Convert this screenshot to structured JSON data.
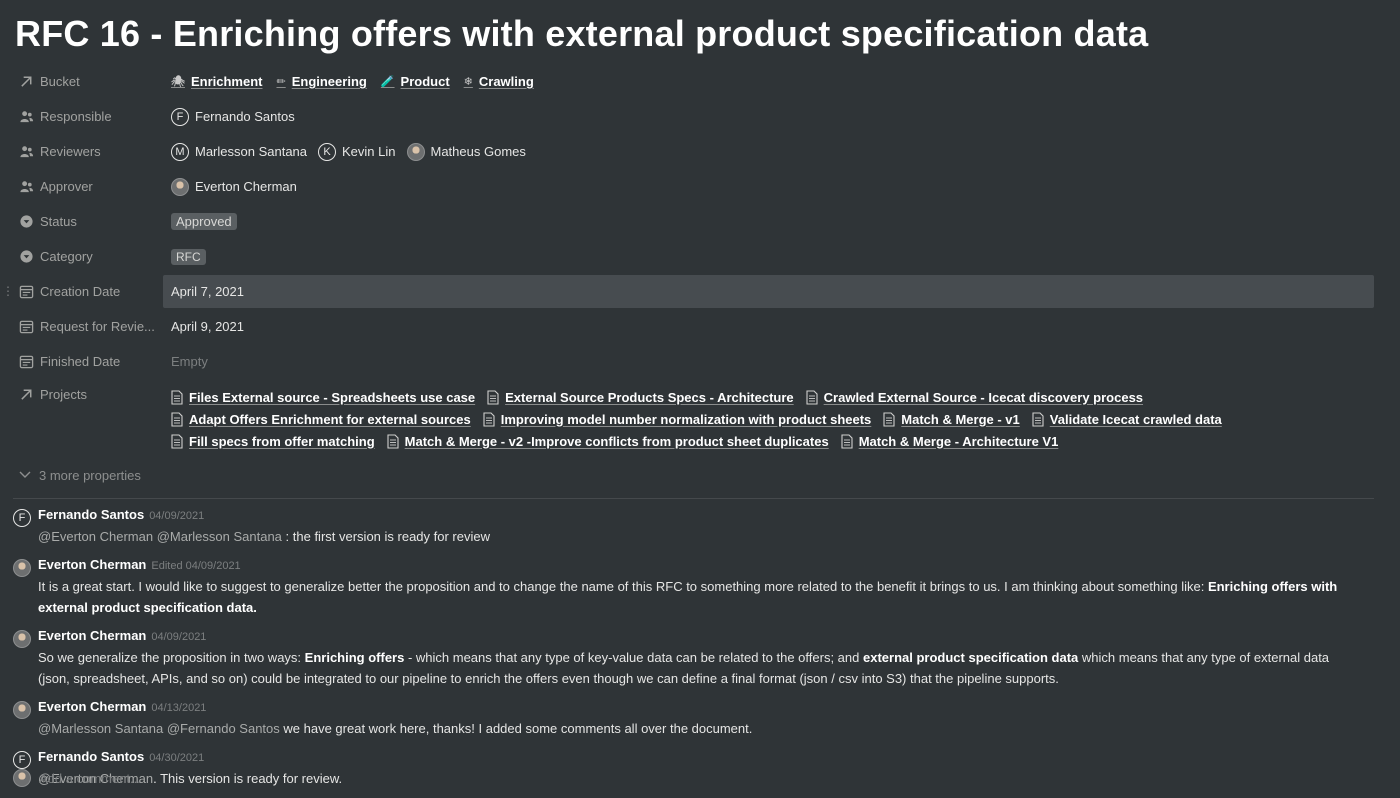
{
  "title": "RFC 16 - Enriching offers with external product specification data",
  "properties": {
    "bucket": {
      "label": "Bucket",
      "items": [
        {
          "label": "Enrichment",
          "emoji": "🕷"
        },
        {
          "label": "Engineering",
          "emoji": "✏"
        },
        {
          "label": "Product",
          "emoji": "🧪"
        },
        {
          "label": "Crawling",
          "emoji": "❄"
        }
      ]
    },
    "responsible": {
      "label": "Responsible",
      "people": [
        {
          "name": "Fernando Santos",
          "initial": "F"
        }
      ]
    },
    "reviewers": {
      "label": "Reviewers",
      "people": [
        {
          "name": "Marlesson Santana",
          "initial": "M"
        },
        {
          "name": "Kevin Lin",
          "initial": "K"
        },
        {
          "name": "Matheus Gomes",
          "initial": ""
        }
      ]
    },
    "approver": {
      "label": "Approver",
      "people": [
        {
          "name": "Everton Cherman",
          "initial": ""
        }
      ]
    },
    "status": {
      "label": "Status",
      "value": "Approved"
    },
    "category": {
      "label": "Category",
      "value": "RFC"
    },
    "creation_date": {
      "label": "Creation Date",
      "value": "April 7, 2021"
    },
    "request_for_review": {
      "label": "Request for Revie...",
      "value": "April 9, 2021"
    },
    "finished_date": {
      "label": "Finished Date",
      "value": "Empty"
    },
    "projects": {
      "label": "Projects",
      "rows": [
        [
          "Files External source - Spreadsheets use case",
          "External Source Products Specs - Architecture",
          "Crawled External Source - Icecat discovery process"
        ],
        [
          "Adapt Offers Enrichment for external sources",
          "Improving model number normalization with product sheets",
          "Match & Merge - v1",
          "Validate Icecat crawled data"
        ],
        [
          "Fill specs from offer matching",
          "Match & Merge - v2 -Improve conflicts from product sheet duplicates",
          "Match & Merge - Architecture V1"
        ]
      ]
    }
  },
  "more_properties": "3 more properties",
  "comments": [
    {
      "author": "Fernando Santos",
      "initial": "F",
      "time": "04/09/2021",
      "mentions": [
        "@Everton Cherman",
        "@Marlesson Santana"
      ],
      "text": " : the first version is ready for review"
    },
    {
      "author": "Everton Cherman",
      "initial": "",
      "time": "Edited 04/09/2021",
      "text_a": "It is a great start. I would like to suggest to generalize better the proposition and to change the name of this RFC to something more related to the benefit it brings to us.  I am thinking about something like: ",
      "bold_a": "Enriching offers with external product specification data."
    },
    {
      "author": "Everton Cherman",
      "initial": "",
      "time": "04/09/2021",
      "text_a": "So we generalize the proposition in two ways: ",
      "bold_a": "Enriching offers",
      "text_b": " - which means that any type of key-value data can be related to the offers;  and ",
      "bold_b": "external product specification data",
      "text_c": " which means that any type of external data (json, spreadsheet, APIs, and so on) could be integrated to our pipeline to enrich the offers even though we can define a final format (json / csv into S3) that the pipeline supports."
    },
    {
      "author": "Everton Cherman",
      "initial": "",
      "time": "04/13/2021",
      "mentions": [
        "@Marlesson Santana",
        "@Fernando Santos"
      ],
      "text": " we have great work here, thanks! I added some comments all over the document."
    },
    {
      "author": "Fernando Santos",
      "initial": "F",
      "time": "04/30/2021",
      "mentions": [
        "@Everton Cherman"
      ],
      "text": ". This version is ready for review."
    }
  ],
  "add_comment_placeholder": "Add a comment..."
}
